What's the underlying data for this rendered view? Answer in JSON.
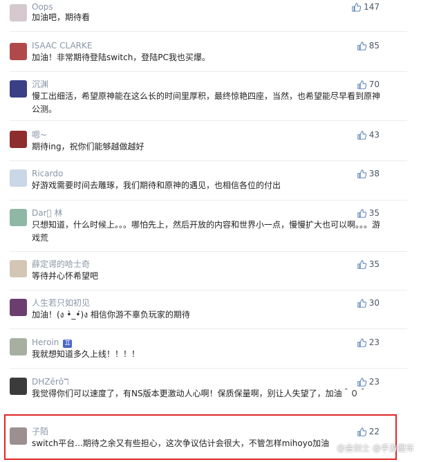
{
  "comments": [
    {
      "name": "Oops",
      "text": "加油吧，期待看",
      "likes": "147",
      "avatar_color": "#d6c8cf"
    },
    {
      "name": "ISAAC CLARKE",
      "text": "加油！非常期待登陆switch，登陆PC我也买爆。",
      "likes": "85",
      "avatar_color": "#b04a4a"
    },
    {
      "name": "沉渊",
      "text": "慢工出细活，希望原神能在这么长的时间里厚积，最终惊艳四座，当然，也希望能尽早看到原神公测。",
      "likes": "70",
      "avatar_color": "#3a3f86"
    },
    {
      "name": "嗯~",
      "text": "期待ing，祝你们能够越做越好",
      "likes": "43",
      "avatar_color": "#8e2d2d"
    },
    {
      "name": "Ricardo",
      "text": "好游戏需要时间去雕琢，我们期待和原神的遇见，也相信各位的付出",
      "likes": "38",
      "avatar_color": "#c9d7e6"
    },
    {
      "name": "Dar\u0000 林",
      "text": "只想知道，什么时候上。。。哪怕先上，然后开放的内容和世界小一点，慢慢扩大也可以啊。。。游戏荒",
      "likes": "35",
      "avatar_color": "#8fb7a5"
    },
    {
      "name": "薛定谔的哈士奇",
      "text": "等待并心怀希望吧",
      "likes": "35",
      "avatar_color": "#d4c6b4"
    },
    {
      "name": "人生若只如初见",
      "text": "加油！(ง •̀_•́)ง 相信你游不辜负玩家的期待",
      "likes": "30",
      "avatar_color": "#6b3e6f"
    },
    {
      "name": "Heroin",
      "text": "我就想知道多久上线！！！！",
      "likes": "23",
      "avatar_color": "#a7b0a0",
      "badge": "♊"
    },
    {
      "name": "DHZērōℸ",
      "text": "我觉得你们可以速度了，有NS版本更激动人心啊！保质保量啊，别让人失望了，加油＾０＾",
      "likes": "23",
      "avatar_color": "#3b3b3b"
    },
    {
      "name": "子陌",
      "text": "switch平台...期待之余又有些担心，这次争议估计会很大，不管怎样mihoyo加油",
      "likes": "22",
      "avatar_color": "#9b8f90"
    }
  ],
  "watermark": "@金剑士 @手游鹿车",
  "icons": {
    "like": "thumbs-up-icon"
  },
  "colors": {
    "highlight": "#e02424",
    "name": "#8a96a8"
  }
}
